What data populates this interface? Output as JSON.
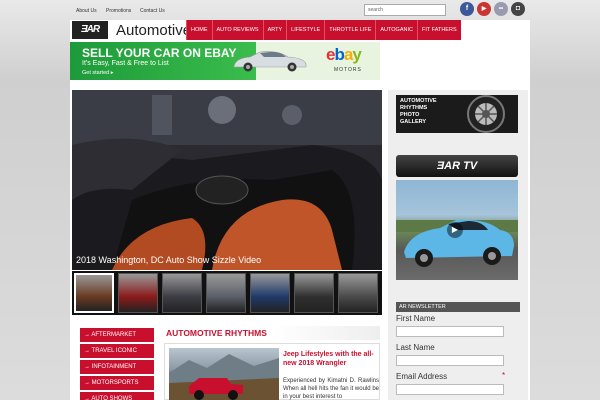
{
  "top_links": [
    "About Us",
    "Promotions",
    "Contact Us"
  ],
  "search": {
    "placeholder": "search"
  },
  "social": [
    {
      "name": "facebook",
      "glyph": "f",
      "color": "#3b5998"
    },
    {
      "name": "youtube",
      "glyph": "▶",
      "color": "#cc3333"
    },
    {
      "name": "flickr",
      "glyph": "••",
      "color": "#9a9ab0"
    },
    {
      "name": "instagram",
      "glyph": "◘",
      "color": "#444444"
    }
  ],
  "site": {
    "logo": "ƎAR",
    "title": "Automotive Rhythms"
  },
  "nav": [
    "HOME",
    "AUTO REVIEWS",
    "ARTY",
    "LIFESTYLE",
    "THROTTLE LIFE",
    "AUTOGANIC",
    "FIT FATHERS"
  ],
  "ad": {
    "headline": "SELL YOUR CAR ON EBAY",
    "subline": "It's Easy, Fast & Free to List",
    "cta": "Get started ▸",
    "brand": "ebay",
    "brand_sub": "MOTORS"
  },
  "hero": {
    "caption": "2018 Washington, DC Auto Show Sizzle Video"
  },
  "thumbnails": [
    {
      "color": "#6a3a22"
    },
    {
      "color": "#8b1a1a"
    },
    {
      "color": "#3c3c44"
    },
    {
      "color": "#5a5f68"
    },
    {
      "color": "#1e3a6a"
    },
    {
      "color": "#2f2f2f"
    },
    {
      "color": "#4a4a4a"
    }
  ],
  "side_menu": [
    "→ AFTERMARKET",
    "→ TRAVEL ICONIC",
    "→ INFOTAINMENT",
    "→ MOTORSPORTS",
    "→ AUTO SHOWS"
  ],
  "section": {
    "title": "AUTOMOTIVE RHYTHMS"
  },
  "article": {
    "title": "Jeep Lifestyles with the all-new 2018 Wrangler",
    "excerpt": "Experienced by Kimatni D. Rawlins When all hell hits the fan it would be in your best interest to"
  },
  "sidebar": {
    "gallery_label": "AUTOMOTIVE RHYTHMS PHOTO GALLERY",
    "artv_label": "ƎAR TV",
    "newsletter": "AR NEWSLETTER",
    "fields": [
      "First Name",
      "Last Name",
      "Email Address"
    ],
    "required_mark": "*"
  },
  "colors": {
    "accent": "#c8102e"
  }
}
